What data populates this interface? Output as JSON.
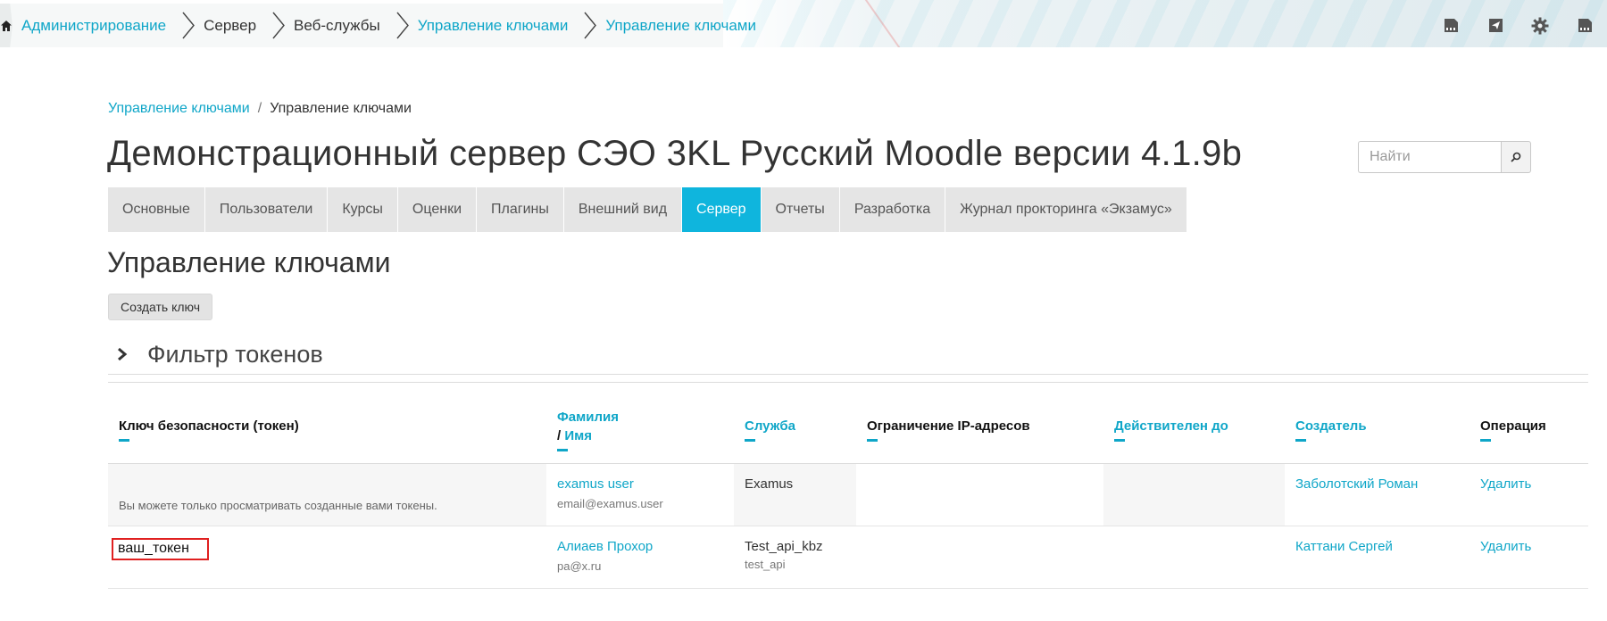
{
  "navbar": {
    "breadcrumbs": [
      {
        "label": "Администрирование",
        "link": true
      },
      {
        "label": "Сервер",
        "link": false
      },
      {
        "label": "Веб-службы",
        "link": false
      },
      {
        "label": "Управление ключами",
        "link": true
      },
      {
        "label": "Управление ключами",
        "link": true
      }
    ],
    "icons": [
      "home-icon",
      "sd-card-icon",
      "paper-plane-icon",
      "gear-icon",
      "sd-card-icon-2"
    ]
  },
  "page": {
    "breadcrumb": {
      "parent": "Управление ключами",
      "separator": "/",
      "current": "Управление ключами"
    },
    "title": "Демонстрационный сервер СЭО 3KL Русский Moodle версии 4.1.9b",
    "search": {
      "placeholder": "Найти",
      "value": ""
    }
  },
  "tabs": [
    {
      "label": "Основные",
      "active": false
    },
    {
      "label": "Пользователи",
      "active": false
    },
    {
      "label": "Курсы",
      "active": false
    },
    {
      "label": "Оценки",
      "active": false
    },
    {
      "label": "Плагины",
      "active": false
    },
    {
      "label": "Внешний вид",
      "active": false
    },
    {
      "label": "Сервер",
      "active": true
    },
    {
      "label": "Отчеты",
      "active": false
    },
    {
      "label": "Разработка",
      "active": false
    },
    {
      "label": "Журнал прокторинга «Экзамус»",
      "active": false
    }
  ],
  "section": {
    "title": "Управление ключами",
    "create_button": "Создать ключ",
    "filter_title": "Фильтр токенов"
  },
  "table": {
    "headers": {
      "token": "Ключ безопасности (токен)",
      "lastname": "Фамилия",
      "name_sep": "/",
      "firstname": "Имя",
      "service": "Служба",
      "ip": "Ограничение IP-адресов",
      "valid_until": "Действителен до",
      "creator": "Создатель",
      "operation": "Операция"
    },
    "rows": [
      {
        "token": "Вы можете только просматривать созданные вами токены.",
        "user": "examus user",
        "email": "email@examus.user",
        "service": "Examus",
        "service_sub": "",
        "ip": "",
        "valid_until": "",
        "creator": "Заболотский Роман",
        "operation": "Удалить"
      },
      {
        "token": "ваш_токен",
        "user": "Алиаев Прохор",
        "email": "pa@x.ru",
        "service": "Test_api_kbz",
        "service_sub": "test_api",
        "ip": "",
        "valid_until": "",
        "creator": "Каттани Сергей",
        "operation": "Удалить"
      }
    ]
  },
  "colors": {
    "accent": "#0fa6c8",
    "active_tab": "#0fb5dd",
    "highlight_box": "#e02020"
  }
}
